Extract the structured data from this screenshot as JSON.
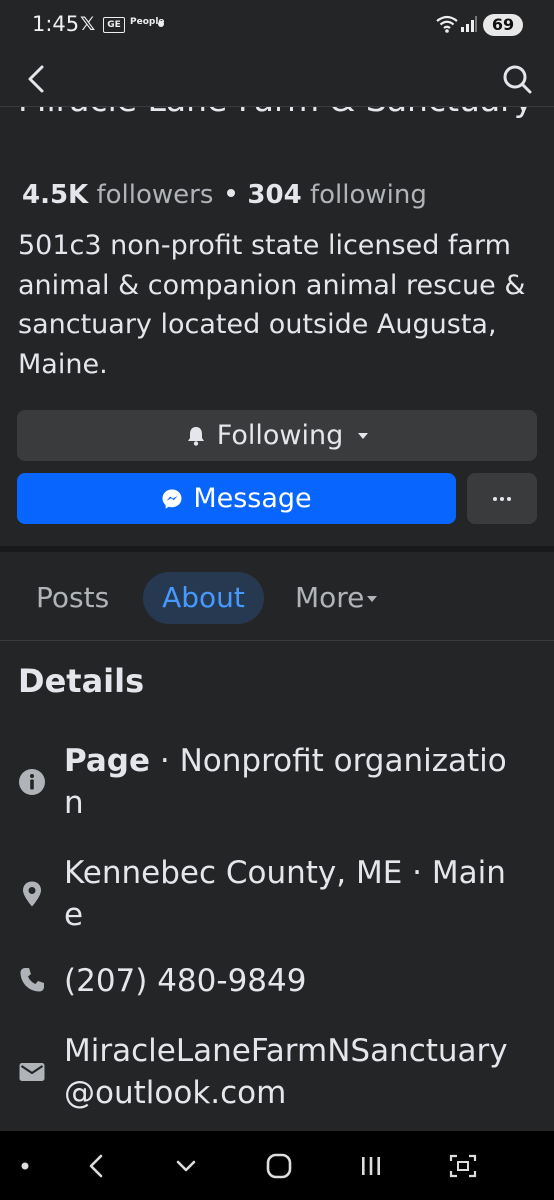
{
  "status_bar": {
    "time": "1:45",
    "x_label": "𝕏",
    "ge_label": "GE",
    "people_label": "People",
    "battery": "69"
  },
  "app_bar": {
    "back_icon": "chevron-left-icon",
    "search_icon": "search-icon"
  },
  "profile": {
    "name": "Miracle Lane Farm & Sanctuary",
    "followers_count": "4.5K",
    "followers_label": "followers",
    "following_count": "304",
    "following_label": "following",
    "bio": "501c3 non-profit state licensed farm animal & companion animal rescue & sanctuary located outside Augusta, Maine."
  },
  "actions": {
    "following_label": "Following",
    "message_label": "Message",
    "more_label": "···"
  },
  "tabs": [
    {
      "label": "Posts",
      "active": false
    },
    {
      "label": "About",
      "active": true
    },
    {
      "label": "More",
      "active": false
    }
  ],
  "details": {
    "heading": "Details",
    "page_label": "Page",
    "page_category": " · Nonprofit organization",
    "location": "Kennebec County, ME · Maine",
    "phone": "(207) 480-9849",
    "email": "MiracleLaneFarmNSanctuary@outlook.com"
  },
  "colors": {
    "background": "#242526",
    "accent_blue": "#0866ff",
    "active_tab_text": "#4599ff",
    "active_tab_bg": "#263951",
    "button_gray": "#3a3b3c"
  }
}
